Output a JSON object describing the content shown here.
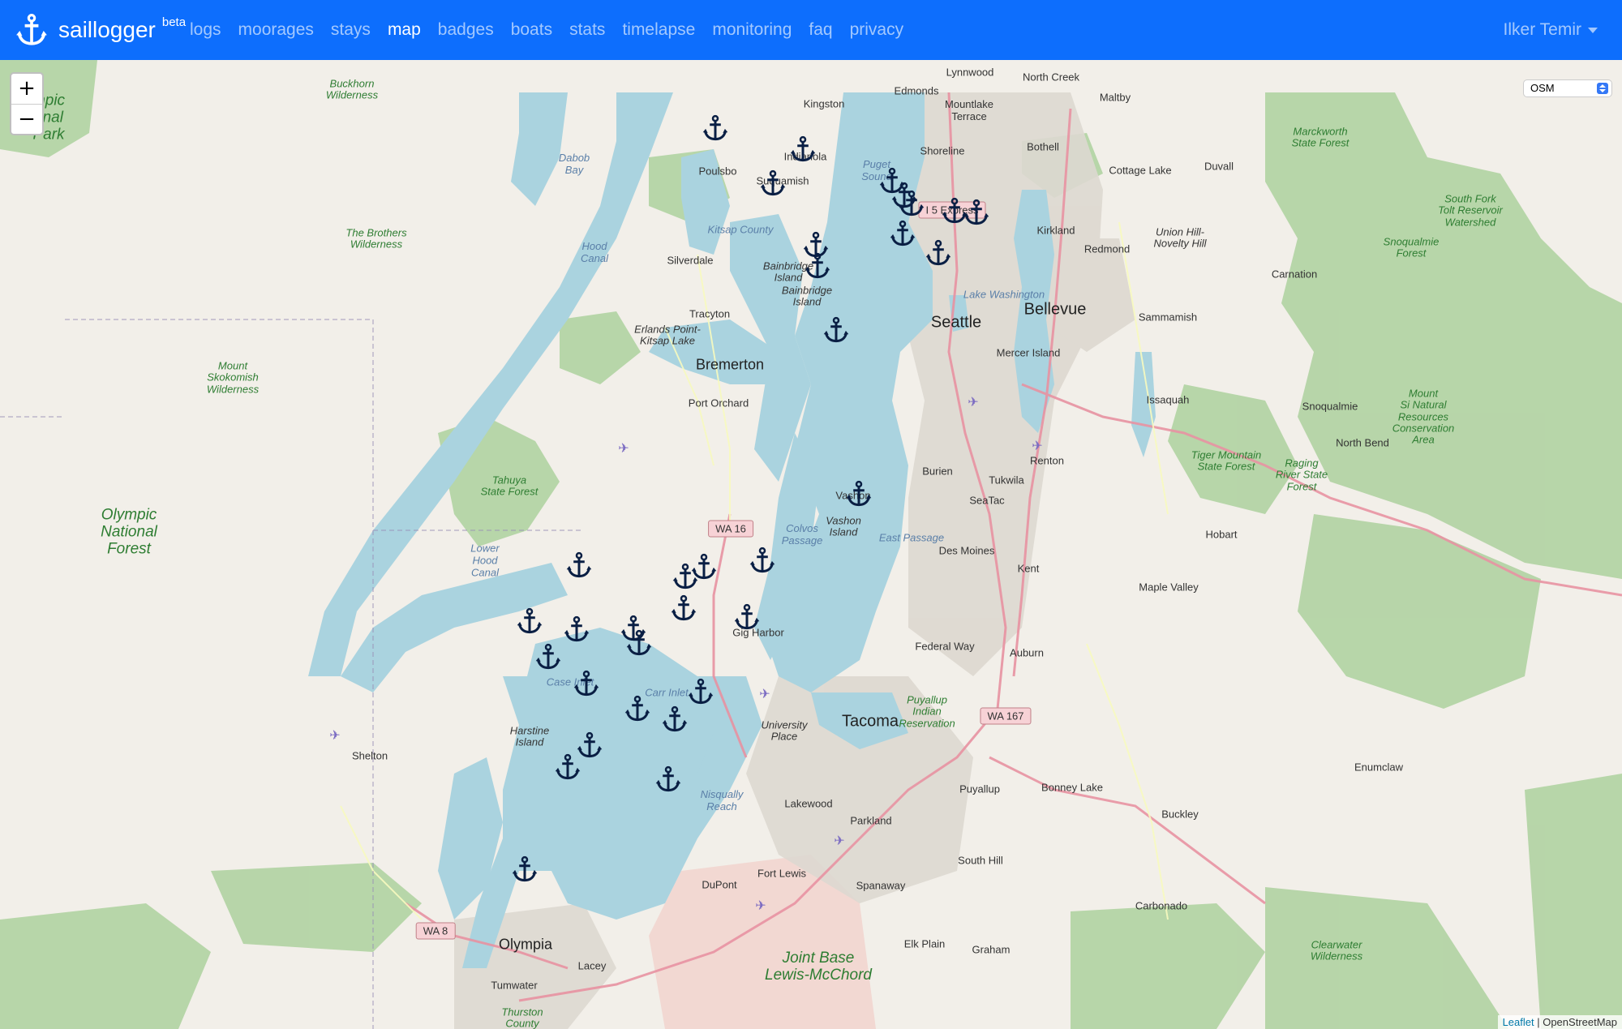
{
  "navbar": {
    "brand": "saillogger",
    "beta": "beta",
    "links": [
      "logs",
      "moorages",
      "stays",
      "map",
      "badges",
      "boats",
      "stats",
      "timelapse",
      "monitoring",
      "faq",
      "privacy"
    ],
    "active": "map",
    "user": "Ilker Temir",
    "bg_color": "#0d6efd"
  },
  "map_controls": {
    "zoom_in": "+",
    "zoom_out": "−",
    "layer": "OSM"
  },
  "attribution": {
    "leaflet": "Leaflet",
    "separator": " | ",
    "osm": "OpenStreetMap"
  },
  "marker_icon": "anchor-icon",
  "marker_color": "#0a1f44",
  "places": {
    "lynnwood": "Lynnwood",
    "north_creek": "North Creek",
    "maltby": "Maltby",
    "edmonds": "Edmonds",
    "kingston": "Kingston",
    "mountlake": "Mountlake\nTerrace",
    "bothell": "Bothell",
    "shoreline": "Shoreline",
    "cottage_lake": "Cottage Lake",
    "duvall": "Duvall",
    "indianola": "Indianola",
    "poulsbo": "Poulsbo",
    "suquamish": "Suquamish",
    "kirkland": "Kirkland",
    "redmond": "Redmond",
    "union_hill": "Union Hill-\nNovelty Hill",
    "carnation": "Carnation",
    "silverdale": "Silverdale",
    "bainbridge_island_label": "Bainbridge\nIsland",
    "bainbridge_city": "Bainbridge\nIsland",
    "tracyton": "Tracyton",
    "erlands": "Erlands Point-\nKitsap Lake",
    "bremerton": "Bremerton",
    "seattle": "Seattle",
    "bellevue": "Bellevue",
    "sammamish": "Sammamish",
    "mercer_island": "Mercer Island",
    "port_orchard": "Port Orchard",
    "issaquah": "Issaquah",
    "snoqualmie": "Snoqualmie",
    "north_bend": "North Bend",
    "renton": "Renton",
    "burien": "Burien",
    "tukwila": "Tukwila",
    "seatac": "SeaTac",
    "vashon": "Vashon",
    "vashon_island": "Vashon\nIsland",
    "des_moines": "Des Moines",
    "hobart": "Hobart",
    "kent": "Kent",
    "maple_valley": "Maple Valley",
    "gig_harbor": "Gig Harbor",
    "federal_way": "Federal Way",
    "auburn": "Auburn",
    "tacoma": "Tacoma",
    "university_place": "University\nPlace",
    "shelton": "Shelton",
    "harstine": "Harstine\nIsland",
    "enumclaw": "Enumclaw",
    "bonney_lake": "Bonney Lake",
    "puyallup": "Puyallup",
    "lakewood": "Lakewood",
    "parkland": "Parkland",
    "buckley": "Buckley",
    "south_hill": "South Hill",
    "fort_lewis": "Fort Lewis",
    "dupont": "DuPont",
    "spanaway": "Spanaway",
    "carbonado": "Carbonado",
    "olympia": "Olympia",
    "lacey": "Lacey",
    "elk_plain": "Elk Plain",
    "graham": "Graham",
    "tumwater": "Tumwater"
  },
  "parks": {
    "buckhorn": "Buckhorn\nWilderness",
    "olympic_np": "mpic\nonal\nPark",
    "brothers": "The Brothers\nWilderness",
    "skokomish": "Mount\nSkokomish\nWilderness",
    "tahuya": "Tahuya\nState Forest",
    "olympic_nf": "Olympic\nNational\nForest",
    "marckworth": "Marckworth\nState Forest",
    "south_fork": "South Fork\nTolt Reservoir\nWatershed",
    "snoqualmie_forest": "Snoqualmie\nForest",
    "tiger": "Tiger Mountain\nState Forest",
    "raging": "Raging\nRiver State\nForest",
    "si_natural": "Mount\nSi Natural\nResources\nConservation\nArea",
    "puyallup_res": "Puyallup\nIndian\nReservation",
    "jblm": "Joint Base\nLewis-McChord",
    "clearwater": "Clearwater\nWilderness",
    "thurston": "Thurston\nCounty"
  },
  "water_labels": {
    "dabob": "Dabob\nBay",
    "hood_canal": "Hood\nCanal",
    "puget_sound": "Puget\nSound",
    "kitsap": "Kitsap County",
    "lake_washington": "Lake Washington",
    "colvos": "Colvos\nPassage",
    "east_passage": "East Passage",
    "lower_hood": "Lower\nHood\nCanal",
    "case_inlet": "Case Inlet",
    "carr_inlet": "Carr Inlet",
    "nisqually": "Nisqually\nReach"
  },
  "shields": {
    "i5": "I 5 Express",
    "wa16": "WA 16",
    "wa167": "WA 167",
    "wa8": "WA 8"
  }
}
